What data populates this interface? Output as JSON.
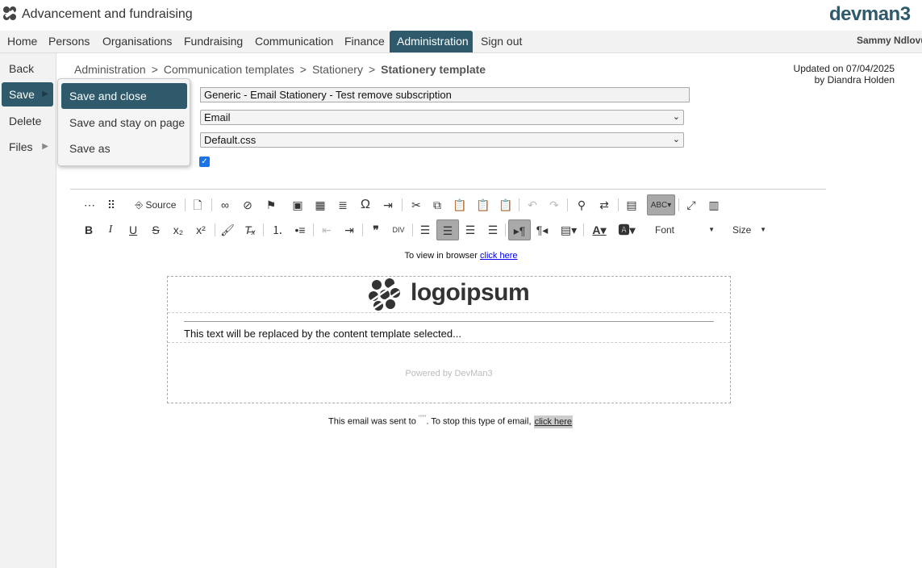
{
  "app": {
    "title": "Advancement and fundraising",
    "brand": "devman3",
    "user": "Sammy Ndlovu"
  },
  "nav": {
    "items": [
      {
        "label": "Home"
      },
      {
        "label": "Persons"
      },
      {
        "label": "Organisations"
      },
      {
        "label": "Fundraising"
      },
      {
        "label": "Communication"
      },
      {
        "label": "Finance"
      },
      {
        "label": "Administration",
        "active": true
      },
      {
        "label": "Sign out"
      }
    ]
  },
  "sidebar": {
    "items": [
      {
        "label": "Back"
      },
      {
        "label": "Save",
        "active": true,
        "arrow": "▶"
      },
      {
        "label": "Delete"
      },
      {
        "label": "Files",
        "arrow": "▶"
      }
    ]
  },
  "save_menu": {
    "items": [
      {
        "label": "Save and close",
        "active": true
      },
      {
        "label": "Save and stay on page"
      },
      {
        "label": "Save as"
      }
    ]
  },
  "breadcrumb": {
    "items": [
      "Administration",
      "Communication templates",
      "Stationery"
    ],
    "separator": ">",
    "current": "Stationery template"
  },
  "updated": {
    "line1": "Updated on 07/04/2025",
    "line2": "by Diandra Holden"
  },
  "form": {
    "name_value": "Generic - Email Stationery - Test remove subscription",
    "type_value": "Email",
    "css_value": "Default.css",
    "active_checked": true
  },
  "toolbar": {
    "source_label": "Source",
    "font_label": "Font",
    "size_label": "Size"
  },
  "editor": {
    "top_text": "To view in browser ",
    "top_link": "click here",
    "logo_text": "logoipsum",
    "content_text": "This text will be replaced by the content template selected...",
    "powered_text": "Powered by DevMan3",
    "bottom_text_1": "This email was sent to ",
    "bottom_placeholder": "\"\"\"",
    "bottom_text_2": ". To stop this type of email, ",
    "bottom_link": "click here"
  },
  "colors": {
    "accent": "#2e5a6b",
    "checkbox": "#1a73e8"
  }
}
